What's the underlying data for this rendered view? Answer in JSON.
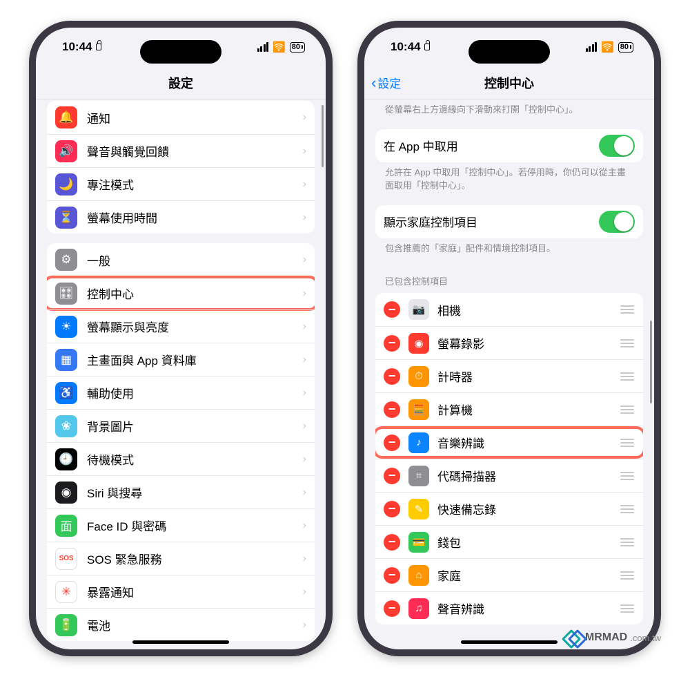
{
  "status": {
    "time": "10:44",
    "battery": "80"
  },
  "left": {
    "title": "設定",
    "rows_a": [
      {
        "icon": "bell-icon",
        "bg": "#ff3b30",
        "glyph": "🔔",
        "label": "通知"
      },
      {
        "icon": "sound-icon",
        "bg": "#ff2d55",
        "glyph": "🔊",
        "label": "聲音與觸覺回饋"
      },
      {
        "icon": "moon-icon",
        "bg": "#5856d6",
        "glyph": "🌙",
        "label": "專注模式"
      },
      {
        "icon": "hourglass-icon",
        "bg": "#5856d6",
        "glyph": "⏳",
        "label": "螢幕使用時間"
      }
    ],
    "rows_b": [
      {
        "icon": "gear-icon",
        "bg": "#8e8e93",
        "glyph": "⚙",
        "label": "一般"
      },
      {
        "icon": "control-center-icon",
        "bg": "#8e8e93",
        "glyph": "🎛",
        "label": "控制中心",
        "highlight": true
      },
      {
        "icon": "brightness-icon",
        "bg": "#007aff",
        "glyph": "☀",
        "label": "螢幕顯示與亮度"
      },
      {
        "icon": "homescreen-icon",
        "bg": "#3478f6",
        "glyph": "▦",
        "label": "主畫面與 App 資料庫"
      },
      {
        "icon": "accessibility-icon",
        "bg": "#007aff",
        "glyph": "♿",
        "label": "輔助使用"
      },
      {
        "icon": "wallpaper-icon",
        "bg": "#54c7ec",
        "glyph": "❀",
        "label": "背景圖片"
      },
      {
        "icon": "standby-icon",
        "bg": "#000000",
        "glyph": "🕘",
        "label": "待機模式"
      },
      {
        "icon": "siri-icon",
        "bg": "#1c1c1e",
        "glyph": "◉",
        "label": "Siri 與搜尋"
      },
      {
        "icon": "faceid-icon",
        "bg": "#34c759",
        "glyph": "⾯",
        "label": "Face ID 與密碼"
      },
      {
        "icon": "sos-icon",
        "bg": "#ffffff",
        "fg": "#ff3b30",
        "glyph": "SOS",
        "label": "SOS 緊急服務"
      },
      {
        "icon": "exposure-icon",
        "bg": "#ffffff",
        "fg": "#ff3b30",
        "glyph": "✳",
        "label": "暴露通知"
      },
      {
        "icon": "battery-icon",
        "bg": "#34c759",
        "glyph": "🔋",
        "label": "電池"
      }
    ]
  },
  "right": {
    "back": "設定",
    "title": "控制中心",
    "intro": "從螢幕右上方邊緣向下滑動來打開「控制中心」。",
    "toggle1": {
      "label": "在 App 中取用",
      "footer": "允許在 App 中取用「控制中心」。若停用時，你仍可以從主畫面取用「控制中心」。"
    },
    "toggle2": {
      "label": "顯示家庭控制項目",
      "footer": "包含推薦的「家庭」配件和情境控制項目。"
    },
    "included_header": "已包含控制項目",
    "items": [
      {
        "icon": "camera-icon",
        "bg": "#e5e5ea",
        "fg": "#555",
        "glyph": "📷",
        "label": "相機"
      },
      {
        "icon": "screen-record-icon",
        "bg": "#ff3b30",
        "glyph": "◉",
        "label": "螢幕錄影"
      },
      {
        "icon": "timer-icon",
        "bg": "#ff9500",
        "glyph": "⏱",
        "label": "計時器"
      },
      {
        "icon": "calculator-icon",
        "bg": "#ff9500",
        "glyph": "🧮",
        "label": "計算機"
      },
      {
        "icon": "shazam-icon",
        "bg": "#0a84ff",
        "glyph": "♪",
        "label": "音樂辨識",
        "highlight": true
      },
      {
        "icon": "qr-icon",
        "bg": "#8e8e93",
        "glyph": "⌗",
        "label": "代碼掃描器"
      },
      {
        "icon": "quicknote-icon",
        "bg": "#ffcc00",
        "glyph": "✎",
        "label": "快速備忘錄"
      },
      {
        "icon": "wallet-icon",
        "bg": "#34c759",
        "glyph": "💳",
        "label": "錢包"
      },
      {
        "icon": "home-icon",
        "bg": "#ff9500",
        "glyph": "⌂",
        "label": "家庭"
      },
      {
        "icon": "sound-recognition-icon",
        "bg": "#ff2d55",
        "glyph": "♫",
        "label": "聲音辨識"
      }
    ]
  },
  "watermark": {
    "brand": "MRMAD",
    "suffix": ".com.tw"
  }
}
